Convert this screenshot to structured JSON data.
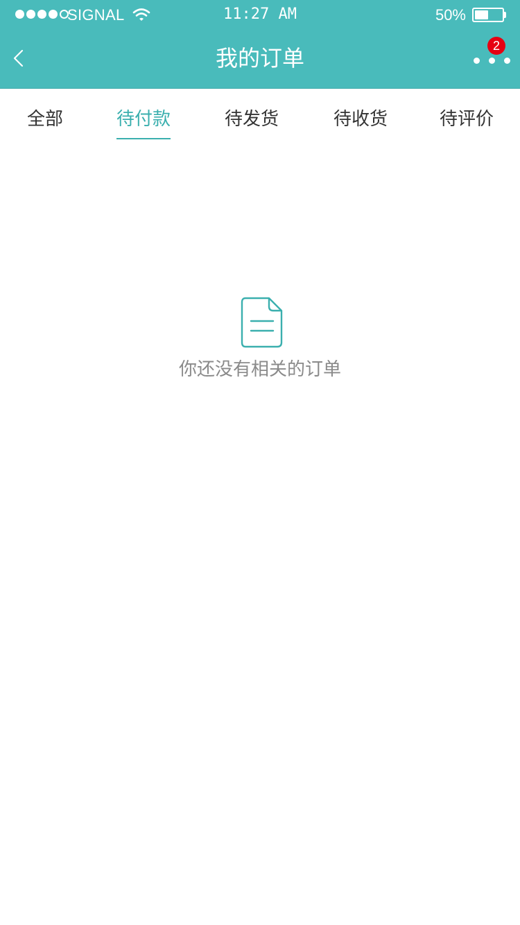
{
  "status_bar": {
    "carrier": "SIGNAL",
    "time": "11:27 AM",
    "battery_percent": "50%",
    "battery_level": 0.5,
    "signal_strength": 4,
    "signal_max": 5
  },
  "nav": {
    "title": "我的订单",
    "back_icon": "chevron-left-icon",
    "more_icon": "more-dots-icon",
    "badge_count": "2"
  },
  "tabs": [
    {
      "label": "全部",
      "active": false
    },
    {
      "label": "待付款",
      "active": true
    },
    {
      "label": "待发货",
      "active": false
    },
    {
      "label": "待收货",
      "active": false
    },
    {
      "label": "待评价",
      "active": false
    }
  ],
  "empty_state": {
    "icon": "document-icon",
    "message": "你还没有相关的订单"
  },
  "colors": {
    "header_bg": "#49bbbb",
    "accent": "#3aafae",
    "badge": "#e60012",
    "tab_text": "#333333",
    "muted_text": "#8a8a8a"
  }
}
